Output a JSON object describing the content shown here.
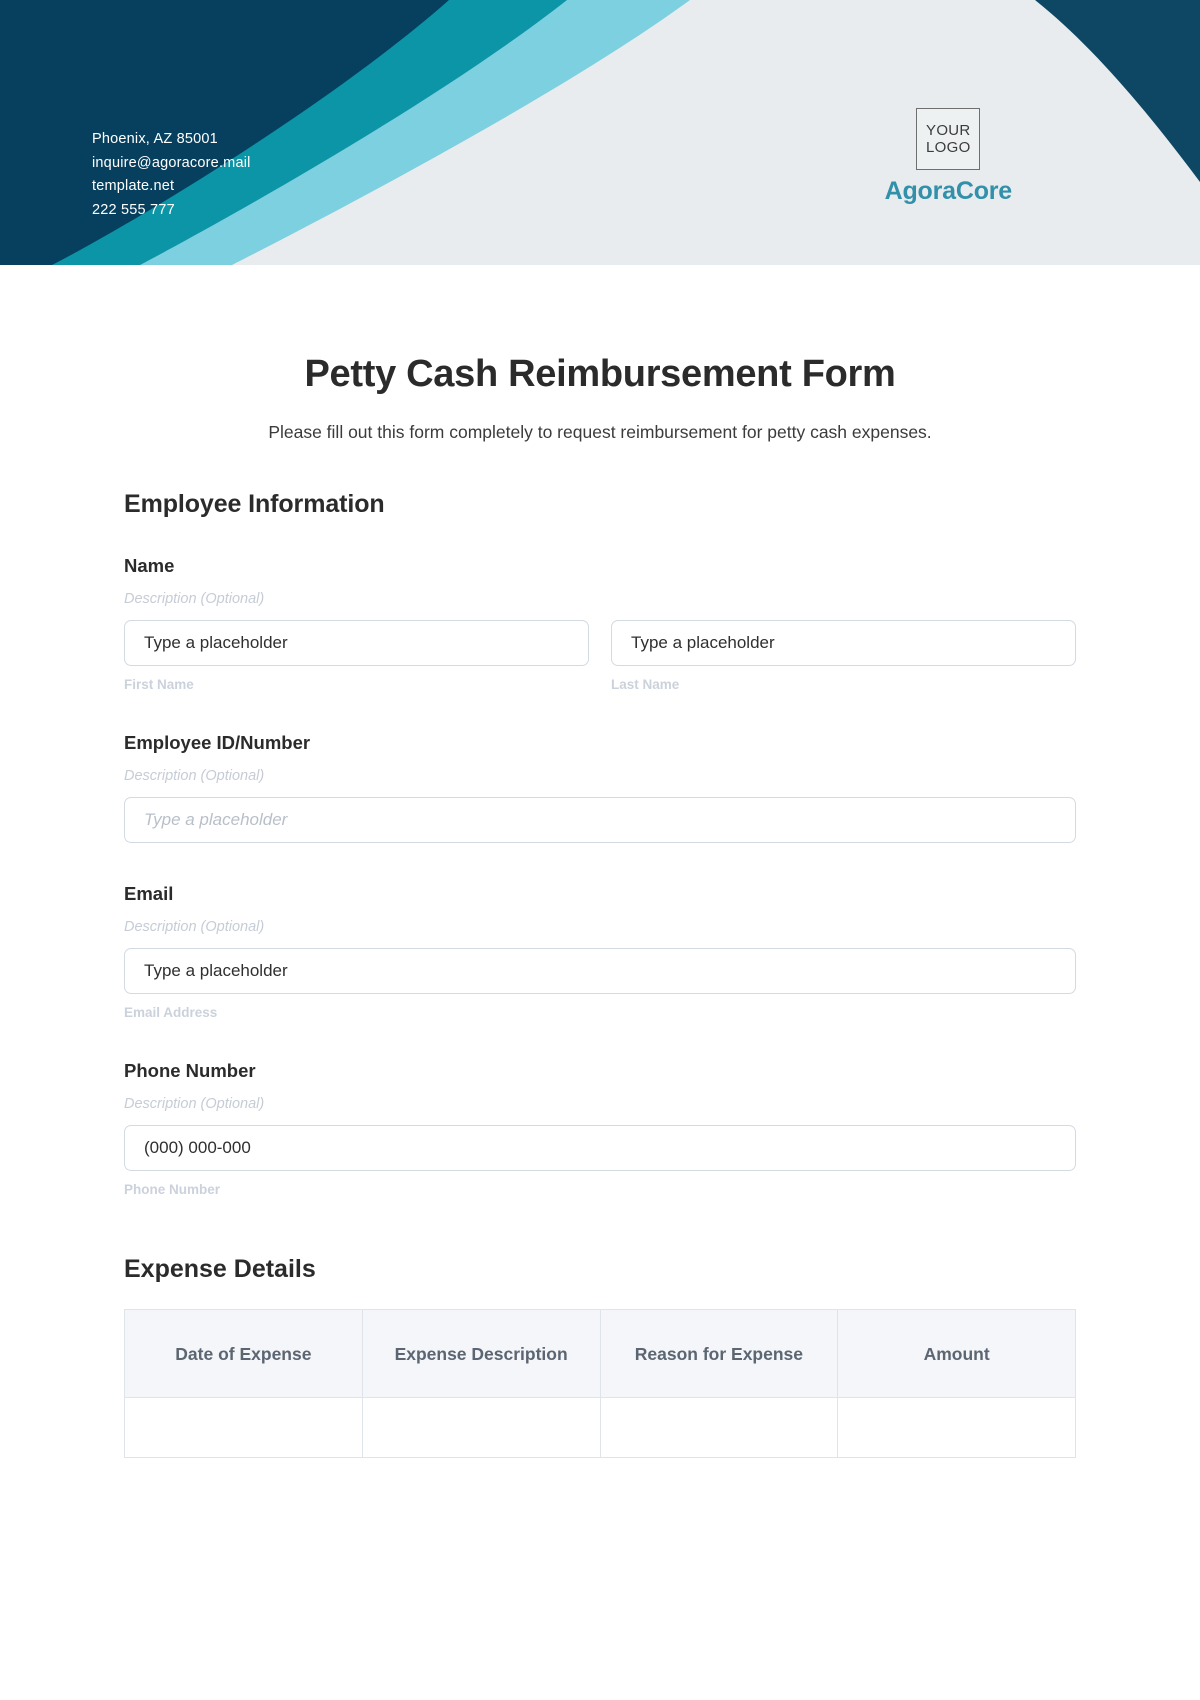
{
  "header": {
    "contact_lines": [
      "Phoenix, AZ 85001",
      "inquire@agoracore.mail",
      "template.net",
      "222 555 777"
    ],
    "logo_line_1": "YOUR",
    "logo_line_2": "LOGO",
    "brand_name": "AgoraCore",
    "colors": {
      "navy": "#06405e",
      "teal": "#0b95a6",
      "cyan": "#7dd0e0",
      "pale": "#e8ecee",
      "brand_text": "#3290ab"
    }
  },
  "form": {
    "title": "Petty Cash Reimbursement Form",
    "subtitle": "Please fill out this form completely to request reimbursement for petty cash expenses.",
    "employee_section_title": "Employee Information",
    "description_hint": "Description (Optional)",
    "fields": {
      "name": {
        "label": "Name",
        "description": "Description (Optional)",
        "first_placeholder": "Type a placeholder",
        "last_placeholder": "Type a placeholder",
        "first_sublabel": "First Name",
        "last_sublabel": "Last Name"
      },
      "employee_id": {
        "label": "Employee ID/Number",
        "description": "Description (Optional)",
        "placeholder": "Type a placeholder"
      },
      "email": {
        "label": "Email",
        "description": "Description (Optional)",
        "placeholder": "Type a placeholder",
        "sublabel": "Email Address"
      },
      "phone": {
        "label": "Phone Number",
        "description": "Description (Optional)",
        "value": "(000) 000-000",
        "sublabel": "Phone Number"
      }
    },
    "expense_section_title": "Expense Details",
    "expense_table": {
      "headers": [
        "Date of Expense",
        "Expense Description",
        "Reason for Expense",
        "Amount"
      ],
      "rows": [
        [
          "",
          "",
          "",
          ""
        ]
      ]
    }
  }
}
